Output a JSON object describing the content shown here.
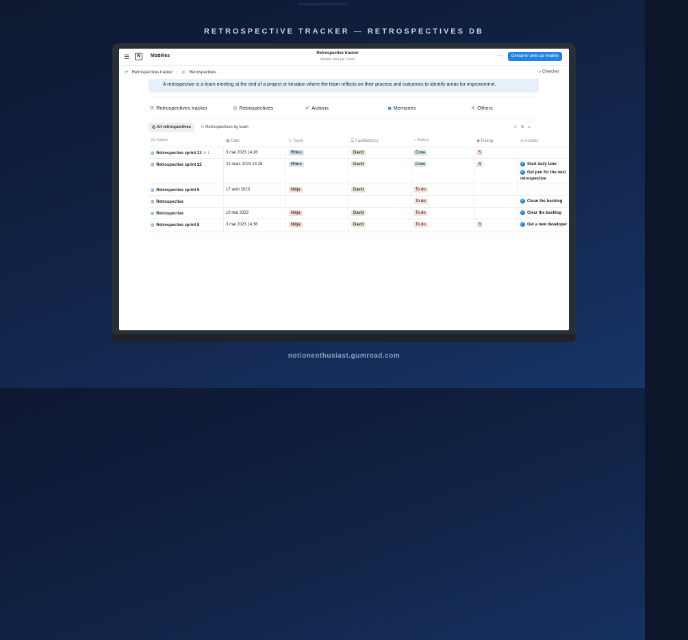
{
  "headline": "RETROSPECTIVE TRACKER — RETROSPECTIVES DB",
  "footer": "notionenthusiast.gumroad.com",
  "topbar": {
    "models": "Modèles",
    "title": "Retrospective tracker",
    "subtitle": "Modèle créé par David",
    "start_button": "Démarrer avec ce modèle"
  },
  "breadcrumb": {
    "item1": "Retrospectives tracker",
    "item2": "Retrospectives",
    "search": "Chercher"
  },
  "callout": "A retrospective is a team meeting at the end of a project or iteration where the team reflects on their process and outcomes to identify areas for improvement.",
  "nav": {
    "tracker": "Retrospectives tracker",
    "retros": "Retrospectives",
    "actions": "Actions",
    "memories": "Memories",
    "others": "Others"
  },
  "views": {
    "all": "All retrospectives",
    "by_team": "Retrospectives by team"
  },
  "columns": {
    "name": "Name",
    "date": "Date",
    "team": "Team",
    "facilitator": "Facilitator(s)",
    "status": "Status",
    "rating": "Rating",
    "actions": "Actions"
  },
  "rows": [
    {
      "name": "Retrospective sprint 23",
      "comments": "1",
      "date": "3 mai 2023 14:28",
      "team": "Rhino",
      "facilitator": "David",
      "status": "Done",
      "rating": "5",
      "actions": []
    },
    {
      "name": "Retrospective sprint 22",
      "date": "22 mars 2023 14:28",
      "team": "Rhino",
      "facilitator": "David",
      "status": "Done",
      "rating": "4",
      "actions": [
        "Start daily later",
        "Get pen for the next retrospective"
      ]
    },
    {
      "name": "Retrospective sprint 9",
      "date": "17 août 2023",
      "team": "Ninja",
      "facilitator": "David",
      "status": "To do",
      "rating": "",
      "actions": []
    },
    {
      "name": "Retrospective",
      "date": "",
      "team": "",
      "facilitator": "",
      "status": "To do",
      "rating": "",
      "actions": [
        "Clean the backlog"
      ]
    },
    {
      "name": "Retrospective",
      "date": "10 mai 2023",
      "team": "Ninja",
      "facilitator": "David",
      "status": "To do",
      "rating": "",
      "actions": [
        "Clear the backlog"
      ]
    },
    {
      "name": "Retrospective sprint 8",
      "date": "3 mai 2023 14:38",
      "team": "Ninja",
      "facilitator": "David",
      "status": "To do",
      "rating": "3",
      "actions": [
        "Get a new developer"
      ]
    }
  ]
}
